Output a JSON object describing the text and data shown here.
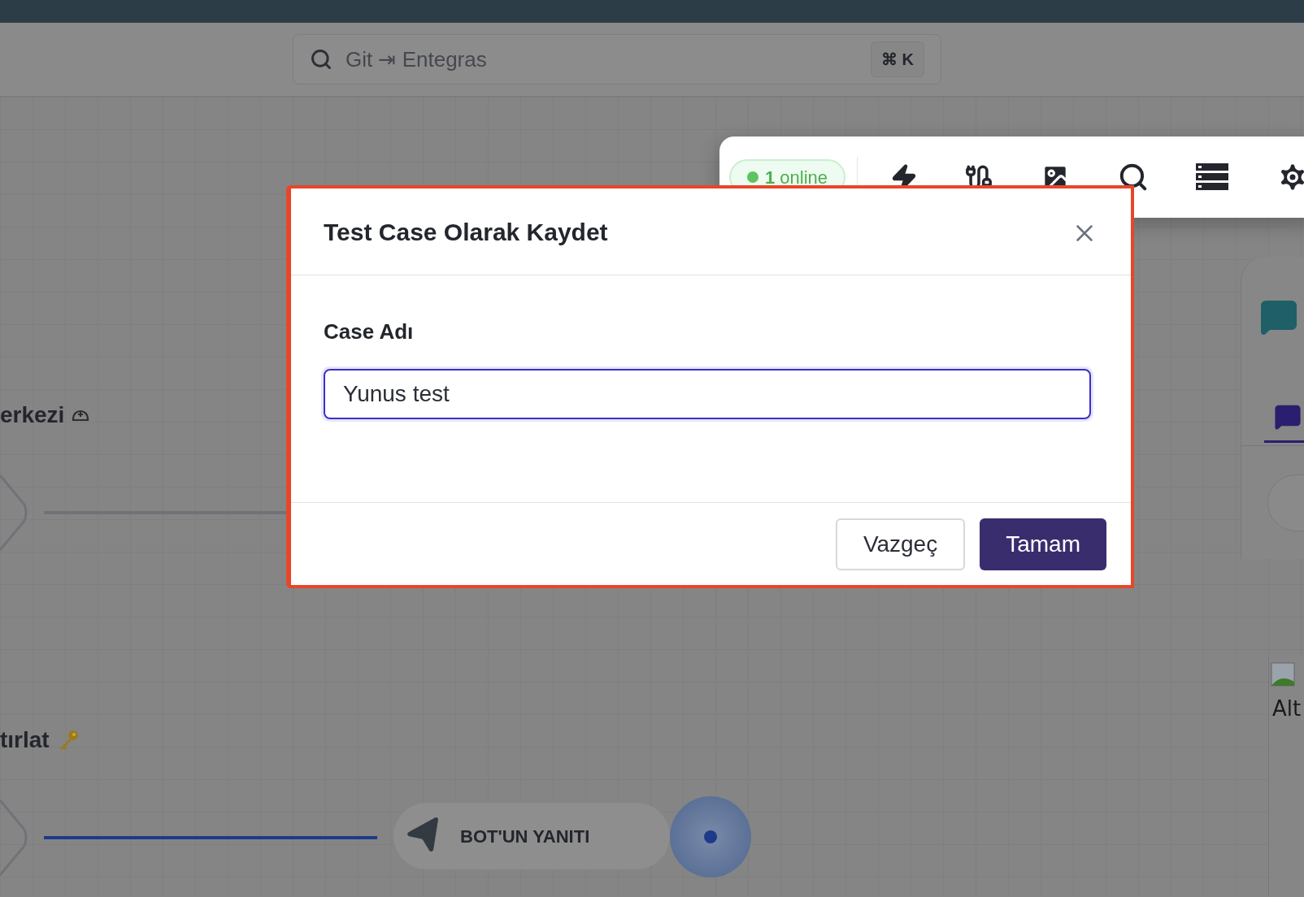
{
  "search": {
    "placeholder": "Git ⇥ Entegras",
    "shortcut": "⌘ K"
  },
  "flows": [
    {
      "title": "erkezi",
      "kind": "helmet",
      "connected": false
    },
    {
      "title": "tırlat",
      "kind": "key",
      "connected": true,
      "node": "BOT'UN YANITI"
    }
  ],
  "toolbar": {
    "status": "**1** online",
    "online": true
  },
  "side_panel": {
    "image_alt": "Alt"
  },
  "dialog": {
    "title": "Test Case Olarak Kaydet",
    "label": "Case Adı",
    "value": "Yunus test",
    "buttons": [
      {
        "label": "Vazgeç",
        "kind": "secondary"
      },
      {
        "label": "Tamam",
        "kind": "primary"
      }
    ]
  }
}
